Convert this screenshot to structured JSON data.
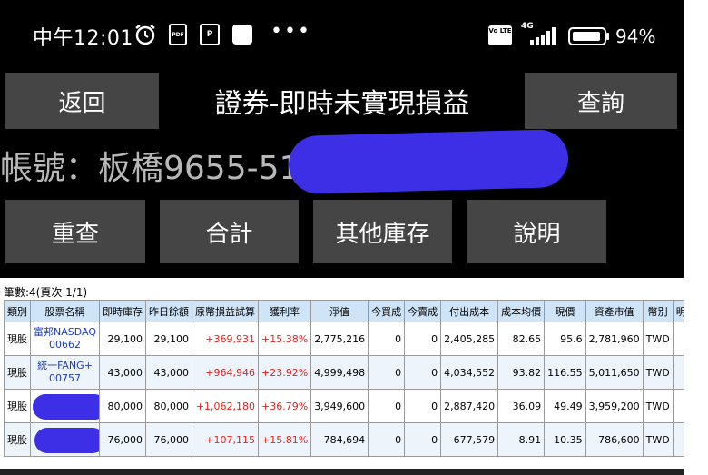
{
  "status_bar": {
    "time": "中午12:01",
    "network_type": "4G",
    "volte_label": "Vo LTE",
    "battery_text": "94%",
    "battery_level": 0.94,
    "pdf_label": "PDF",
    "p_label": "P",
    "overflow_dots": "•••"
  },
  "header": {
    "back_label": "返回",
    "title": "證券-即時未實現損益",
    "query_label": "查詢"
  },
  "account": {
    "text": "帳號：板橋9655-51"
  },
  "actions": {
    "recheck_label": "重查",
    "total_label": "合計",
    "other_inventory_label": "其他庫存",
    "help_label": "說明"
  },
  "table": {
    "summary": "筆數:4(頁次 1/1)",
    "columns": [
      "類別",
      "股票名稱",
      "即時庫存",
      "昨日餘額",
      "原幣損益試算",
      "獲利率",
      "淨值",
      "今買成",
      "今賣成",
      "付出成本",
      "成本均價",
      "現價",
      "資產市值",
      "幣別",
      "明細"
    ],
    "rows": [
      {
        "kind": "現股",
        "name_line1": "富邦NASDAQ",
        "name_line2": "00662",
        "rt_qty": "29,100",
        "prev_bal": "29,100",
        "pnl": "+369,931",
        "rate": "+15.38%",
        "net": "2,775,216",
        "buy_today": "0",
        "sell_today": "0",
        "cost": "2,405,285",
        "avg_cost": "82.65",
        "price": "95.6",
        "market_value": "2,781,960",
        "currency": "TWD",
        "detail": ""
      },
      {
        "kind": "現股",
        "name_line1": "統一FANG+",
        "name_line2": "00757",
        "rt_qty": "43,000",
        "prev_bal": "43,000",
        "pnl": "+964,946",
        "rate": "+23.92%",
        "net": "4,999,498",
        "buy_today": "0",
        "sell_today": "0",
        "cost": "4,034,552",
        "avg_cost": "93.82",
        "price": "116.55",
        "market_value": "5,011,650",
        "currency": "TWD",
        "detail": ""
      },
      {
        "kind": "現股",
        "name_line1": "",
        "name_line2": "",
        "rt_qty": "80,000",
        "prev_bal": "80,000",
        "pnl": "+1,062,180",
        "rate": "+36.79%",
        "net": "3,949,600",
        "buy_today": "0",
        "sell_today": "0",
        "cost": "2,887,420",
        "avg_cost": "36.09",
        "price": "49.49",
        "market_value": "3,959,200",
        "currency": "TWD",
        "detail": ""
      },
      {
        "kind": "現股",
        "name_line1": "",
        "name_line2": "",
        "rt_qty": "76,000",
        "prev_bal": "76,000",
        "pnl": "+107,115",
        "rate": "+15.81%",
        "net": "784,694",
        "buy_today": "0",
        "sell_today": "0",
        "cost": "677,579",
        "avg_cost": "8.91",
        "price": "10.35",
        "market_value": "786,600",
        "currency": "TWD",
        "detail": ""
      }
    ]
  },
  "colors": {
    "background": "#000000",
    "button": "#454545",
    "header_row": "#d0e4f7",
    "alt_row": "#edf4fc",
    "gain_red": "#e0231c",
    "name_blue": "#1f3fb0",
    "redaction": "#3c2fe6"
  },
  "icons": [
    "alarm-icon",
    "pdf-icon",
    "p-icon",
    "square-icon",
    "more-dots-icon",
    "volte-icon",
    "signal-icon",
    "battery-icon"
  ]
}
